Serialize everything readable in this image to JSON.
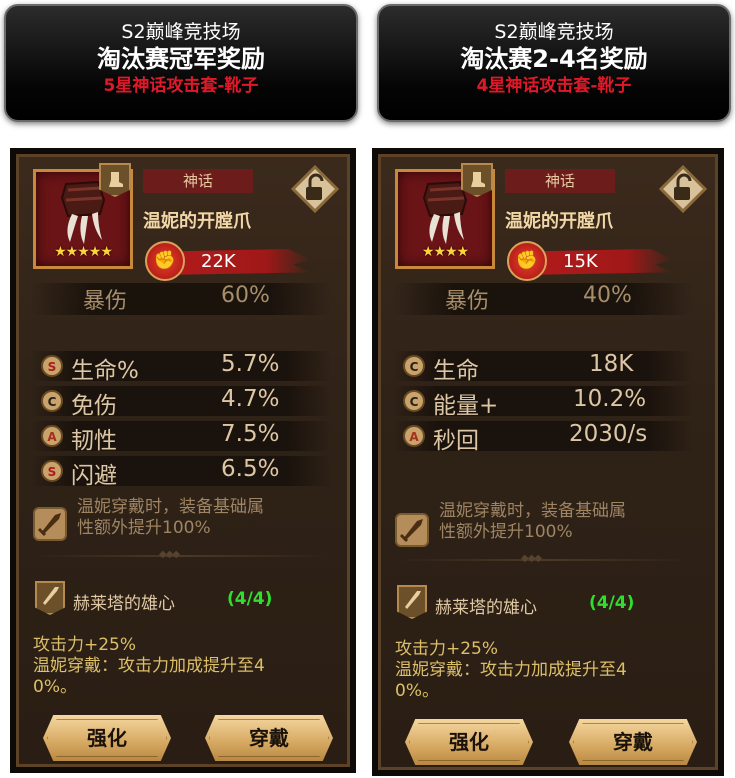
{
  "cards": [
    {
      "banner": {
        "line1": "S2巅峰竞技场",
        "line2": "淘汰赛冠军奖励",
        "line3": "5星神话攻击套-靴子"
      },
      "rarity": "神话",
      "item_name": "温妮的开膛爪",
      "stars": "★★★★★",
      "power": "22K",
      "main_stat": {
        "label": "暴伤",
        "value": "60%"
      },
      "attributes": [
        {
          "grade": "S",
          "name": "生命%",
          "value": "5.7%"
        },
        {
          "grade": "C",
          "name": "免伤",
          "value": "4.7%"
        },
        {
          "grade": "A",
          "name": "韧性",
          "value": "7.5%"
        },
        {
          "grade": "S",
          "name": "闪避",
          "value": "6.5%"
        }
      ],
      "skill_line1": "温妮穿戴时，装备基础属",
      "skill_line2": "性额外提升100%",
      "set_name": "赫莱塔的雄心",
      "set_count": "(4/4)",
      "bonus_line1": "攻击力+25%",
      "bonus_line2": "温妮穿戴：攻击力加成提升至4",
      "bonus_line3": "0%。",
      "btn_upgrade": "强化",
      "btn_equip": "穿戴"
    },
    {
      "banner": {
        "line1": "S2巅峰竞技场",
        "line2": "淘汰赛2-4名奖励",
        "line3": "4星神话攻击套-靴子"
      },
      "rarity": "神话",
      "item_name": "温妮的开膛爪",
      "stars": "★★★★",
      "power": "15K",
      "main_stat": {
        "label": "暴伤",
        "value": "40%"
      },
      "attributes": [
        {
          "grade": "C",
          "name": "生命",
          "value": "18K"
        },
        {
          "grade": "C",
          "name": "能量+",
          "value": "10.2%"
        },
        {
          "grade": "A",
          "name": "秒回",
          "value": "2030/s"
        }
      ],
      "skill_line1": "温妮穿戴时，装备基础属",
      "skill_line2": "性额外提升100%",
      "set_name": "赫莱塔的雄心",
      "set_count": "(4/4)",
      "bonus_line1": "攻击力+25%",
      "bonus_line2": "温妮穿戴：攻击力加成提升至4",
      "bonus_line3": "0%。",
      "btn_upgrade": "强化",
      "btn_equip": "穿戴"
    }
  ],
  "icons": {
    "item": "claw-icon",
    "lock": "unlock-icon",
    "power": "fist-icon",
    "skill": "sword-icon",
    "set": "dagger-icon"
  },
  "colors": {
    "grade_S": "#b01a1a",
    "set_count": "#2fde2f",
    "rarity_bg": "#6d1c1c"
  }
}
